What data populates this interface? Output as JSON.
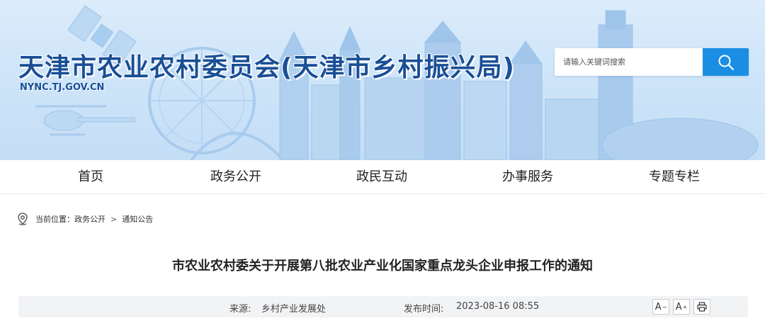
{
  "header": {
    "title": "天津市农业农村委员会(天津市乡村振兴局)",
    "domain": "NYNC.TJ.GOV.CN",
    "search": {
      "placeholder": "请输入关键词搜索",
      "icon": "search-icon"
    }
  },
  "nav": {
    "items": [
      {
        "label": "首页"
      },
      {
        "label": "政务公开"
      },
      {
        "label": "政民互动"
      },
      {
        "label": "办事服务"
      },
      {
        "label": "专题专栏"
      }
    ]
  },
  "breadcrumb": {
    "icon": "location-pin-icon",
    "prefix": "当前位置：",
    "items": [
      "政务公开",
      "通知公告"
    ],
    "separator": ">"
  },
  "article": {
    "title": "市农业农村委关于开展第八批农业产业化国家重点龙头企业申报工作的通知",
    "source_label": "来源:",
    "source": "乡村产业发展处",
    "date_label": "发布时间:",
    "date": "2023-08-16 08:55",
    "tools": {
      "font_decrease": "A",
      "font_increase": "A",
      "print_icon": "printer-icon"
    }
  },
  "colors": {
    "brand": "#1a4f96",
    "search_button": "#1b8ee4",
    "banner_bg": "#cfe5f9",
    "meta_bar_bg": "#f2f3f5"
  }
}
